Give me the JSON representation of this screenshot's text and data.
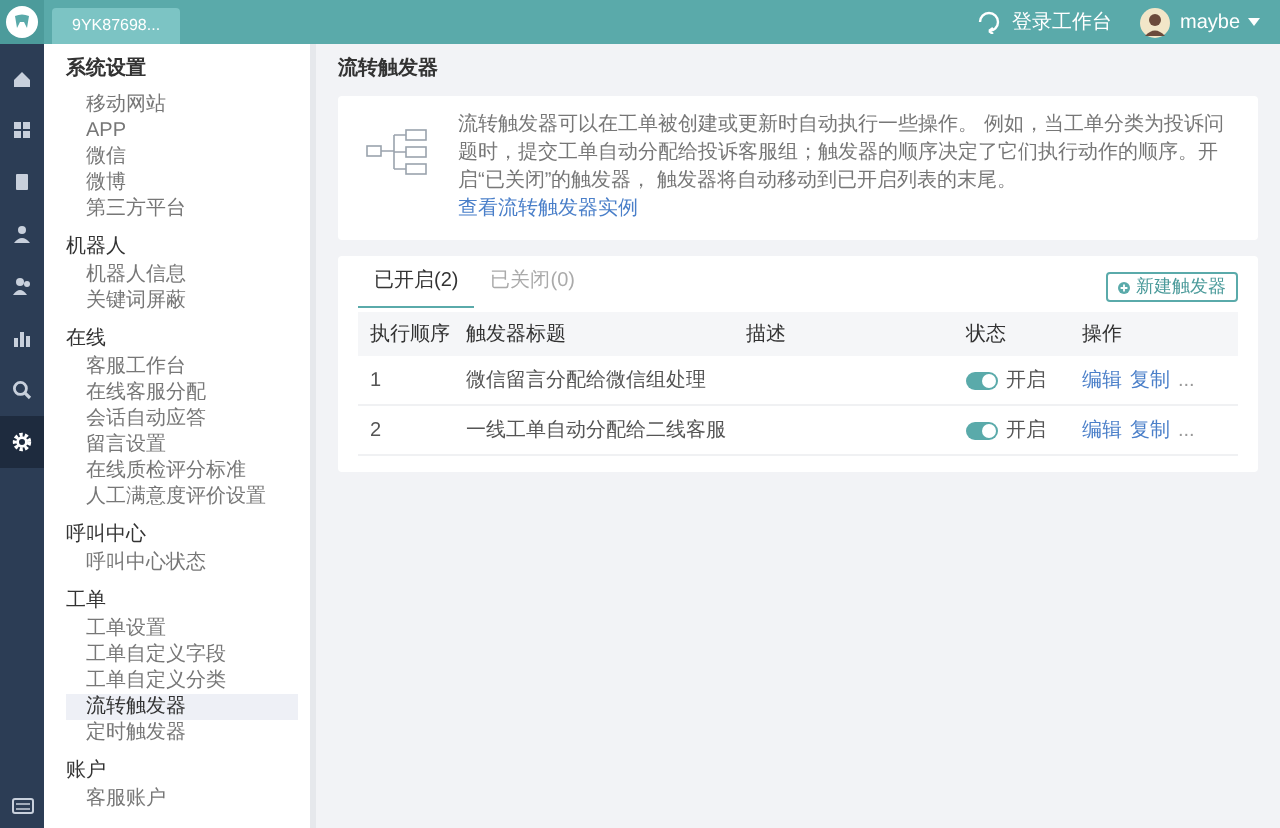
{
  "app_tab": {
    "label": "9YK87698..."
  },
  "rail": [
    {
      "kind": "home",
      "selected": false
    },
    {
      "kind": "grid",
      "selected": false
    },
    {
      "kind": "book",
      "selected": false
    },
    {
      "kind": "person",
      "selected": false
    },
    {
      "kind": "people",
      "selected": false
    },
    {
      "kind": "chart",
      "selected": false
    },
    {
      "kind": "search",
      "selected": false
    },
    {
      "kind": "settings",
      "selected": true
    }
  ],
  "header": {
    "workbench_link": "登录工作台",
    "user": "maybe"
  },
  "sidebar": {
    "title": "系统设置",
    "groups": [
      {
        "items": [
          {
            "label": "移动网站",
            "selected": false
          },
          {
            "label": "APP",
            "selected": false
          },
          {
            "label": "微信",
            "selected": false
          },
          {
            "label": "微博",
            "selected": false
          },
          {
            "label": "第三方平台",
            "selected": false
          }
        ]
      },
      {
        "heading": "机器人",
        "items": [
          {
            "label": "机器人信息",
            "selected": false
          },
          {
            "label": "关键词屏蔽",
            "selected": false
          }
        ]
      },
      {
        "heading": "在线",
        "items": [
          {
            "label": "客服工作台",
            "selected": false
          },
          {
            "label": "在线客服分配",
            "selected": false
          },
          {
            "label": "会话自动应答",
            "selected": false
          },
          {
            "label": "留言设置",
            "selected": false
          },
          {
            "label": "在线质检评分标准",
            "selected": false
          },
          {
            "label": "人工满意度评价设置",
            "selected": false
          }
        ]
      },
      {
        "heading": "呼叫中心",
        "items": [
          {
            "label": "呼叫中心状态",
            "selected": false
          }
        ]
      },
      {
        "heading": "工单",
        "items": [
          {
            "label": "工单设置",
            "selected": false
          },
          {
            "label": "工单自定义字段",
            "selected": false
          },
          {
            "label": "工单自定义分类",
            "selected": false
          },
          {
            "label": "流转触发器",
            "selected": true
          },
          {
            "label": "定时触发器",
            "selected": false
          }
        ]
      },
      {
        "heading": "账户",
        "items": [
          {
            "label": "客服账户",
            "selected": false
          }
        ]
      }
    ]
  },
  "page": {
    "title": "流转触发器",
    "info": {
      "description": "流转触发器可以在工单被创建或更新时自动执行一些操作。 例如，当工单分类为投诉问题时，提交工单自动分配给投诉客服组；触发器的顺序决定了它们执行动作的顺序。开启“已关闭”的触发器， 触发器将自动移动到已开启列表的末尾。",
      "link": "查看流转触发器实例"
    },
    "tabs": [
      {
        "label": "已开启(2)",
        "selected": true
      },
      {
        "label": "已关闭(0)",
        "selected": false
      }
    ],
    "new_button": "新建触发器",
    "table": {
      "columns": [
        "执行顺序",
        "触发器标题",
        "描述",
        "状态",
        "操作"
      ],
      "rows": [
        {
          "order": "1",
          "title": "微信留言分配给微信组处理",
          "on": true,
          "status": "开启",
          "actions": [
            "编辑",
            "复制",
            "..."
          ]
        },
        {
          "order": "2",
          "title": "一线工单自动分配给二线客服",
          "on": true,
          "status": "开启",
          "actions": [
            "编辑",
            "复制",
            "..."
          ]
        }
      ]
    }
  }
}
